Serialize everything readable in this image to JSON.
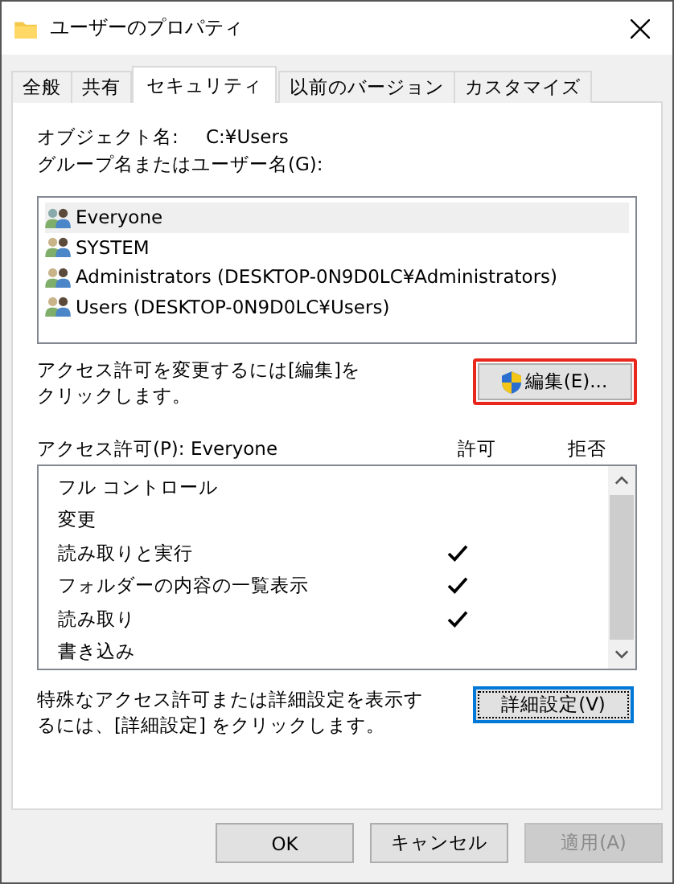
{
  "window": {
    "title": "ユーザーのプロパティ"
  },
  "tabs": [
    {
      "label": "全般",
      "selected": false
    },
    {
      "label": "共有",
      "selected": false
    },
    {
      "label": "セキュリティ",
      "selected": true
    },
    {
      "label": "以前のバージョン",
      "selected": false
    },
    {
      "label": "カスタマイズ",
      "selected": false
    }
  ],
  "object_name": {
    "label": "オブジェクト名:",
    "value": "C:¥Users"
  },
  "groups_label": "グループ名またはユーザー名(G):",
  "groups": [
    {
      "name": "Everyone",
      "selected": true
    },
    {
      "name": "SYSTEM",
      "selected": false
    },
    {
      "name": "Administrators (DESKTOP-0N9D0LC¥Administrators)",
      "selected": false
    },
    {
      "name": "Users (DESKTOP-0N9D0LC¥Users)",
      "selected": false
    }
  ],
  "edit_hint": "アクセス許可を変更するには[編集]をクリックします。",
  "edit_button": {
    "label": "編集(E)...",
    "highlighted": true
  },
  "permissions_label": "アクセス許可(P): Everyone",
  "columns": [
    "許可",
    "拒否"
  ],
  "permissions": [
    {
      "name": "フル コントロール",
      "allow": false,
      "deny": false
    },
    {
      "name": "変更",
      "allow": false,
      "deny": false
    },
    {
      "name": "読み取りと実行",
      "allow": true,
      "deny": false
    },
    {
      "name": "フォルダーの内容の一覧表示",
      "allow": true,
      "deny": false
    },
    {
      "name": "読み取り",
      "allow": true,
      "deny": false
    },
    {
      "name": "書き込み",
      "allow": false,
      "deny": false
    }
  ],
  "advanced_hint": "特殊なアクセス許可または詳細設定を表示するには、[詳細設定] をクリックします。",
  "advanced_button": {
    "label": "詳細設定(V)",
    "focused": true
  },
  "buttons": [
    {
      "label": "OK",
      "disabled": false
    },
    {
      "label": "キャンセル",
      "disabled": false
    },
    {
      "label": "適用(A)",
      "disabled": true
    }
  ]
}
